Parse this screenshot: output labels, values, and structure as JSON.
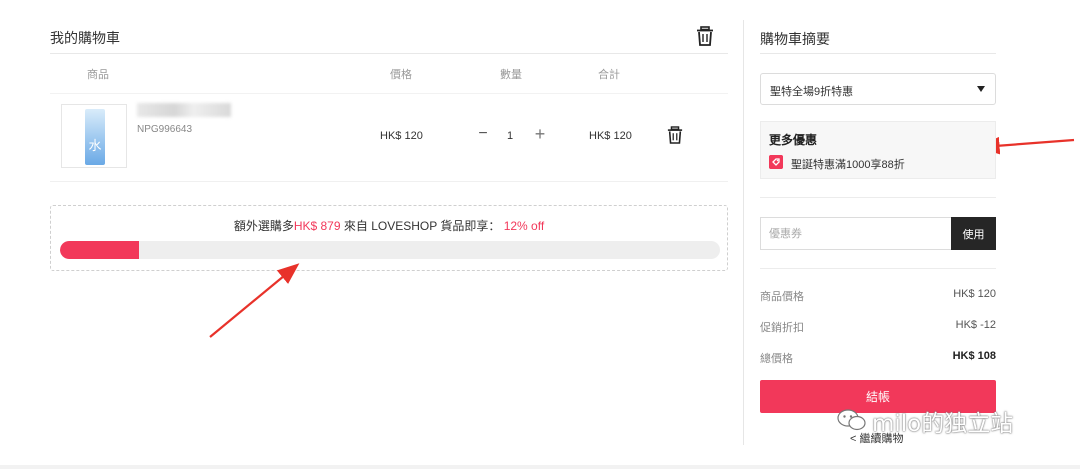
{
  "cart": {
    "title": "我的購物車",
    "columns": {
      "product": "商品",
      "price": "價格",
      "quantity": "數量",
      "total": "合計"
    },
    "items": [
      {
        "sku": "NPG996643",
        "price": "HK$ 120",
        "quantity": "1",
        "minus": "−",
        "plus": "+",
        "total": "HK$ 120"
      }
    ]
  },
  "promo_bar": {
    "prefix": "額外選購多",
    "amount": "HK$ 879",
    "middle": " 來自 LOVESHOP 貨品即享： ",
    "discount": "12% off",
    "progress": 0.12
  },
  "summary": {
    "title": "購物車摘要",
    "promo_select": "聖特全場9折特惠",
    "more_offers": {
      "title": "更多優惠",
      "item": "聖誕特惠滿1000享88折"
    },
    "coupon": {
      "placeholder": "優惠券",
      "button": "使用"
    },
    "rows": [
      {
        "label": "商品價格",
        "value": "HK$ 120"
      },
      {
        "label": "促銷折扣",
        "value": "HK$ -12"
      },
      {
        "label": "總價格",
        "value": "HK$ 108"
      }
    ],
    "checkout": "結帳",
    "continue": "< 繼續購物"
  },
  "watermark": "milo的独立站",
  "colors": {
    "accent": "#f2385a",
    "dark_button": "#262626",
    "annotation_arrow": "#e8322a"
  },
  "icons": [
    "trash-icon",
    "tag-icon",
    "caret-down-icon",
    "wechat-icon"
  ]
}
